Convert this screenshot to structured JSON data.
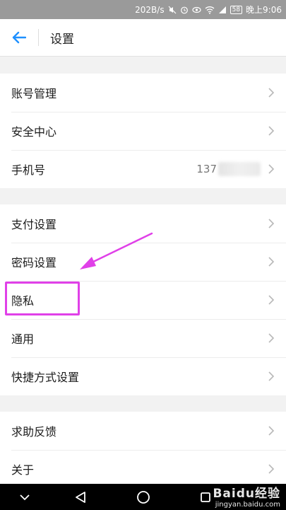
{
  "status_bar": {
    "speed": "202B/s",
    "battery": "58",
    "time": "晚上9:06"
  },
  "header": {
    "title": "设置"
  },
  "groups": [
    {
      "items": [
        {
          "label": "账号管理"
        },
        {
          "label": "安全中心"
        },
        {
          "label": "手机号",
          "value": "137"
        }
      ]
    },
    {
      "items": [
        {
          "label": "支付设置"
        },
        {
          "label": "密码设置"
        },
        {
          "label": "隐私"
        },
        {
          "label": "通用"
        },
        {
          "label": "快捷方式设置"
        }
      ]
    },
    {
      "items": [
        {
          "label": "求助反馈"
        },
        {
          "label": "关于"
        }
      ]
    }
  ],
  "annotation": {
    "color": "#e040e8"
  },
  "watermark": {
    "main": "Baidu经验",
    "sub": "jingyan.baidu.com"
  },
  "colors": {
    "accent": "#1e90ff",
    "status_bar": "#9a9a9a"
  }
}
